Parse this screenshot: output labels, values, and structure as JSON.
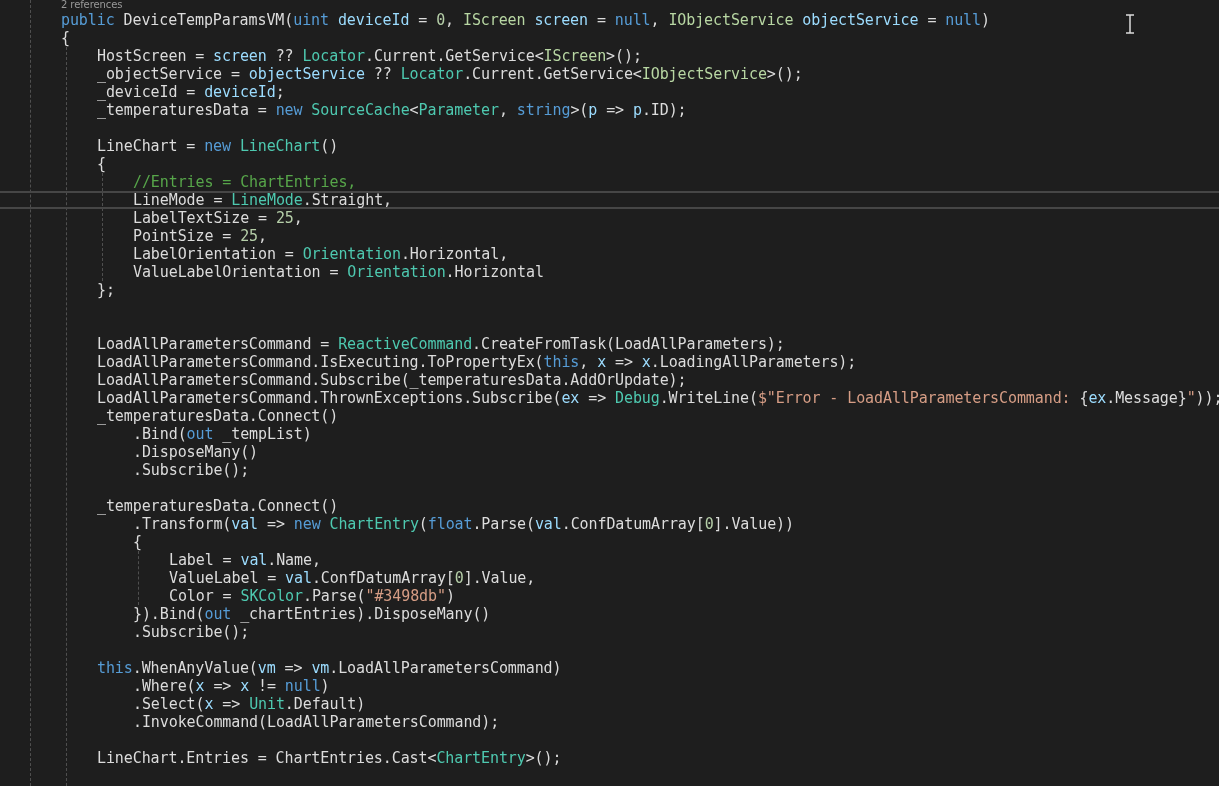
{
  "editor": {
    "codelens": "2 references",
    "lines": [
      {
        "kind": "code",
        "current": false,
        "tokens": [
          {
            "kind": "keyword",
            "text": "public"
          },
          {
            "kind": "plain",
            "text": " DeviceTempParamsVM("
          },
          {
            "kind": "keyword",
            "text": "uint"
          },
          {
            "kind": "variable",
            "text": " deviceId"
          },
          {
            "kind": "plain",
            "text": " = "
          },
          {
            "kind": "number",
            "text": "0"
          },
          {
            "kind": "plain",
            "text": ", "
          },
          {
            "kind": "interface",
            "text": "IScreen"
          },
          {
            "kind": "variable",
            "text": " screen"
          },
          {
            "kind": "plain",
            "text": " = "
          },
          {
            "kind": "keyword",
            "text": "null"
          },
          {
            "kind": "plain",
            "text": ", "
          },
          {
            "kind": "interface",
            "text": "IObjectService"
          },
          {
            "kind": "variable",
            "text": " objectService"
          },
          {
            "kind": "plain",
            "text": " = "
          },
          {
            "kind": "keyword",
            "text": "null"
          },
          {
            "kind": "plain",
            "text": ")"
          }
        ]
      },
      {
        "kind": "code",
        "current": false,
        "guide": true,
        "tokens": [
          {
            "kind": "plain",
            "text": "{"
          }
        ],
        "children": [
          {
            "kind": "code",
            "current": false,
            "tokens": [
              {
                "kind": "plain",
                "text": "HostScreen = "
              },
              {
                "kind": "variable",
                "text": "screen"
              },
              {
                "kind": "plain",
                "text": " ?? "
              },
              {
                "kind": "type",
                "text": "Locator"
              },
              {
                "kind": "plain",
                "text": ".Current.GetService<"
              },
              {
                "kind": "interface",
                "text": "IScreen"
              },
              {
                "kind": "plain",
                "text": ">();"
              }
            ]
          },
          {
            "kind": "code",
            "current": false,
            "tokens": [
              {
                "kind": "plain",
                "text": "_objectService = "
              },
              {
                "kind": "variable",
                "text": "objectService"
              },
              {
                "kind": "plain",
                "text": " ?? "
              },
              {
                "kind": "type",
                "text": "Locator"
              },
              {
                "kind": "plain",
                "text": ".Current.GetService<"
              },
              {
                "kind": "interface",
                "text": "IObjectService"
              },
              {
                "kind": "plain",
                "text": ">();"
              }
            ]
          },
          {
            "kind": "code",
            "current": false,
            "tokens": [
              {
                "kind": "plain",
                "text": "_deviceId = "
              },
              {
                "kind": "variable",
                "text": "deviceId"
              },
              {
                "kind": "plain",
                "text": ";"
              }
            ]
          },
          {
            "kind": "code",
            "current": false,
            "tokens": [
              {
                "kind": "plain",
                "text": "_temperaturesData = "
              },
              {
                "kind": "keyword",
                "text": "new"
              },
              {
                "kind": "type",
                "text": " SourceCache"
              },
              {
                "kind": "plain",
                "text": "<"
              },
              {
                "kind": "type",
                "text": "Parameter"
              },
              {
                "kind": "plain",
                "text": ", "
              },
              {
                "kind": "keyword",
                "text": "string"
              },
              {
                "kind": "plain",
                "text": ">("
              },
              {
                "kind": "variable",
                "text": "p"
              },
              {
                "kind": "plain",
                "text": " => "
              },
              {
                "kind": "variable",
                "text": "p"
              },
              {
                "kind": "plain",
                "text": ".ID);"
              }
            ]
          },
          {
            "kind": "blank",
            "current": false
          },
          {
            "kind": "code",
            "current": false,
            "tokens": [
              {
                "kind": "plain",
                "text": "LineChart = "
              },
              {
                "kind": "keyword",
                "text": "new"
              },
              {
                "kind": "type",
                "text": " LineChart"
              },
              {
                "kind": "plain",
                "text": "()"
              }
            ]
          },
          {
            "kind": "code",
            "current": false,
            "guide": true,
            "tokens": [
              {
                "kind": "plain",
                "text": "{"
              }
            ],
            "children": [
              {
                "kind": "code",
                "current": false,
                "tokens": [
                  {
                    "kind": "comment",
                    "text": "//Entries = ChartEntries,"
                  }
                ]
              },
              {
                "kind": "code",
                "current": true,
                "tokens": [
                  {
                    "kind": "plain",
                    "text": "LineMode = "
                  },
                  {
                    "kind": "type",
                    "text": "LineMode"
                  },
                  {
                    "kind": "plain",
                    "text": ".Straight,"
                  }
                ]
              },
              {
                "kind": "code",
                "current": false,
                "tokens": [
                  {
                    "kind": "plain",
                    "text": "LabelTextSize = "
                  },
                  {
                    "kind": "number",
                    "text": "25"
                  },
                  {
                    "kind": "plain",
                    "text": ","
                  }
                ]
              },
              {
                "kind": "code",
                "current": false,
                "tokens": [
                  {
                    "kind": "plain",
                    "text": "PointSize = "
                  },
                  {
                    "kind": "number",
                    "text": "25"
                  },
                  {
                    "kind": "plain",
                    "text": ","
                  }
                ]
              },
              {
                "kind": "code",
                "current": false,
                "tokens": [
                  {
                    "kind": "plain",
                    "text": "LabelOrientation = "
                  },
                  {
                    "kind": "type",
                    "text": "Orientation"
                  },
                  {
                    "kind": "plain",
                    "text": ".Horizontal,"
                  }
                ]
              },
              {
                "kind": "code",
                "current": false,
                "tokens": [
                  {
                    "kind": "plain",
                    "text": "ValueLabelOrientation = "
                  },
                  {
                    "kind": "type",
                    "text": "Orientation"
                  },
                  {
                    "kind": "plain",
                    "text": ".Horizontal"
                  }
                ]
              }
            ]
          },
          {
            "kind": "code",
            "current": false,
            "tokens": [
              {
                "kind": "plain",
                "text": "};"
              }
            ]
          },
          {
            "kind": "blank",
            "current": false
          },
          {
            "kind": "blank",
            "current": false
          },
          {
            "kind": "code",
            "current": false,
            "tokens": [
              {
                "kind": "plain",
                "text": "LoadAllParametersCommand = "
              },
              {
                "kind": "type",
                "text": "ReactiveCommand"
              },
              {
                "kind": "plain",
                "text": ".CreateFromTask(LoadAllParameters);"
              }
            ]
          },
          {
            "kind": "code",
            "current": false,
            "tokens": [
              {
                "kind": "plain",
                "text": "LoadAllParametersCommand.IsExecuting.ToPropertyEx("
              },
              {
                "kind": "keyword",
                "text": "this"
              },
              {
                "kind": "plain",
                "text": ", "
              },
              {
                "kind": "variable",
                "text": "x"
              },
              {
                "kind": "plain",
                "text": " => "
              },
              {
                "kind": "variable",
                "text": "x"
              },
              {
                "kind": "plain",
                "text": ".LoadingAllParameters);"
              }
            ]
          },
          {
            "kind": "code",
            "current": false,
            "tokens": [
              {
                "kind": "plain",
                "text": "LoadAllParametersCommand.Subscribe(_temperaturesData.AddOrUpdate);"
              }
            ]
          },
          {
            "kind": "code",
            "current": false,
            "tokens": [
              {
                "kind": "plain",
                "text": "LoadAllParametersCommand.ThrownExceptions.Subscribe("
              },
              {
                "kind": "variable",
                "text": "ex"
              },
              {
                "kind": "plain",
                "text": " => "
              },
              {
                "kind": "type",
                "text": "Debug"
              },
              {
                "kind": "plain",
                "text": ".WriteLine("
              },
              {
                "kind": "string",
                "text": "$\"Error - LoadAllParametersCommand: "
              },
              {
                "kind": "plain",
                "text": "{"
              },
              {
                "kind": "variable",
                "text": "ex"
              },
              {
                "kind": "plain",
                "text": ".Message}"
              },
              {
                "kind": "string",
                "text": "\""
              },
              {
                "kind": "plain",
                "text": "));"
              }
            ]
          },
          {
            "kind": "code",
            "current": false,
            "guide": false,
            "tokens": [
              {
                "kind": "plain",
                "text": "_temperaturesData.Connect()"
              }
            ],
            "children": [
              {
                "kind": "code",
                "current": false,
                "tokens": [
                  {
                    "kind": "plain",
                    "text": ".Bind("
                  },
                  {
                    "kind": "keyword",
                    "text": "out"
                  },
                  {
                    "kind": "plain",
                    "text": " _tempList)"
                  }
                ]
              },
              {
                "kind": "code",
                "current": false,
                "tokens": [
                  {
                    "kind": "plain",
                    "text": ".DisposeMany()"
                  }
                ]
              },
              {
                "kind": "code",
                "current": false,
                "tokens": [
                  {
                    "kind": "plain",
                    "text": ".Subscribe();"
                  }
                ]
              }
            ]
          },
          {
            "kind": "blank",
            "current": false
          },
          {
            "kind": "code",
            "current": false,
            "guide": false,
            "tokens": [
              {
                "kind": "plain",
                "text": "_temperaturesData.Connect()"
              }
            ],
            "children": [
              {
                "kind": "code",
                "current": false,
                "tokens": [
                  {
                    "kind": "plain",
                    "text": ".Transform("
                  },
                  {
                    "kind": "variable",
                    "text": "val"
                  },
                  {
                    "kind": "plain",
                    "text": " => "
                  },
                  {
                    "kind": "keyword",
                    "text": "new"
                  },
                  {
                    "kind": "type",
                    "text": " ChartEntry"
                  },
                  {
                    "kind": "plain",
                    "text": "("
                  },
                  {
                    "kind": "keyword",
                    "text": "float"
                  },
                  {
                    "kind": "plain",
                    "text": ".Parse("
                  },
                  {
                    "kind": "variable",
                    "text": "val"
                  },
                  {
                    "kind": "plain",
                    "text": ".ConfDatumArray["
                  },
                  {
                    "kind": "number",
                    "text": "0"
                  },
                  {
                    "kind": "plain",
                    "text": "].Value))"
                  }
                ]
              },
              {
                "kind": "code",
                "current": false,
                "guide": true,
                "tokens": [
                  {
                    "kind": "plain",
                    "text": "{"
                  }
                ],
                "children": [
                  {
                    "kind": "code",
                    "current": false,
                    "tokens": [
                      {
                        "kind": "plain",
                        "text": "Label = "
                      },
                      {
                        "kind": "variable",
                        "text": "val"
                      },
                      {
                        "kind": "plain",
                        "text": ".Name,"
                      }
                    ]
                  },
                  {
                    "kind": "code",
                    "current": false,
                    "tokens": [
                      {
                        "kind": "plain",
                        "text": "ValueLabel = "
                      },
                      {
                        "kind": "variable",
                        "text": "val"
                      },
                      {
                        "kind": "plain",
                        "text": ".ConfDatumArray["
                      },
                      {
                        "kind": "number",
                        "text": "0"
                      },
                      {
                        "kind": "plain",
                        "text": "].Value,"
                      }
                    ]
                  },
                  {
                    "kind": "code",
                    "current": false,
                    "tokens": [
                      {
                        "kind": "plain",
                        "text": "Color = "
                      },
                      {
                        "kind": "type",
                        "text": "SKColor"
                      },
                      {
                        "kind": "plain",
                        "text": ".Parse("
                      },
                      {
                        "kind": "string",
                        "text": "\"#3498db\""
                      },
                      {
                        "kind": "plain",
                        "text": ")"
                      }
                    ]
                  }
                ]
              },
              {
                "kind": "code",
                "current": false,
                "tokens": [
                  {
                    "kind": "plain",
                    "text": "}).Bind("
                  },
                  {
                    "kind": "keyword",
                    "text": "out"
                  },
                  {
                    "kind": "plain",
                    "text": " _chartEntries).DisposeMany()"
                  }
                ]
              },
              {
                "kind": "code",
                "current": false,
                "tokens": [
                  {
                    "kind": "plain",
                    "text": ".Subscribe();"
                  }
                ]
              }
            ]
          },
          {
            "kind": "blank",
            "current": false
          },
          {
            "kind": "code",
            "current": false,
            "guide": false,
            "tokens": [
              {
                "kind": "keyword",
                "text": "this"
              },
              {
                "kind": "plain",
                "text": ".WhenAnyValue("
              },
              {
                "kind": "variable",
                "text": "vm"
              },
              {
                "kind": "plain",
                "text": " => "
              },
              {
                "kind": "variable",
                "text": "vm"
              },
              {
                "kind": "plain",
                "text": ".LoadAllParametersCommand)"
              }
            ],
            "children": [
              {
                "kind": "code",
                "current": false,
                "tokens": [
                  {
                    "kind": "plain",
                    "text": ".Where("
                  },
                  {
                    "kind": "variable",
                    "text": "x"
                  },
                  {
                    "kind": "plain",
                    "text": " => "
                  },
                  {
                    "kind": "variable",
                    "text": "x"
                  },
                  {
                    "kind": "plain",
                    "text": " != "
                  },
                  {
                    "kind": "keyword",
                    "text": "null"
                  },
                  {
                    "kind": "plain",
                    "text": ")"
                  }
                ]
              },
              {
                "kind": "code",
                "current": false,
                "tokens": [
                  {
                    "kind": "plain",
                    "text": ".Select("
                  },
                  {
                    "kind": "variable",
                    "text": "x"
                  },
                  {
                    "kind": "plain",
                    "text": " => "
                  },
                  {
                    "kind": "type",
                    "text": "Unit"
                  },
                  {
                    "kind": "plain",
                    "text": ".Default)"
                  }
                ]
              },
              {
                "kind": "code",
                "current": false,
                "tokens": [
                  {
                    "kind": "plain",
                    "text": ".InvokeCommand(LoadAllParametersCommand);"
                  }
                ]
              }
            ]
          },
          {
            "kind": "blank",
            "current": false
          },
          {
            "kind": "code",
            "current": false,
            "tokens": [
              {
                "kind": "plain",
                "text": "LineChart.Entries = ChartEntries.Cast<"
              },
              {
                "kind": "type",
                "text": "ChartEntry"
              },
              {
                "kind": "plain",
                "text": ">();"
              }
            ]
          }
        ]
      }
    ]
  }
}
